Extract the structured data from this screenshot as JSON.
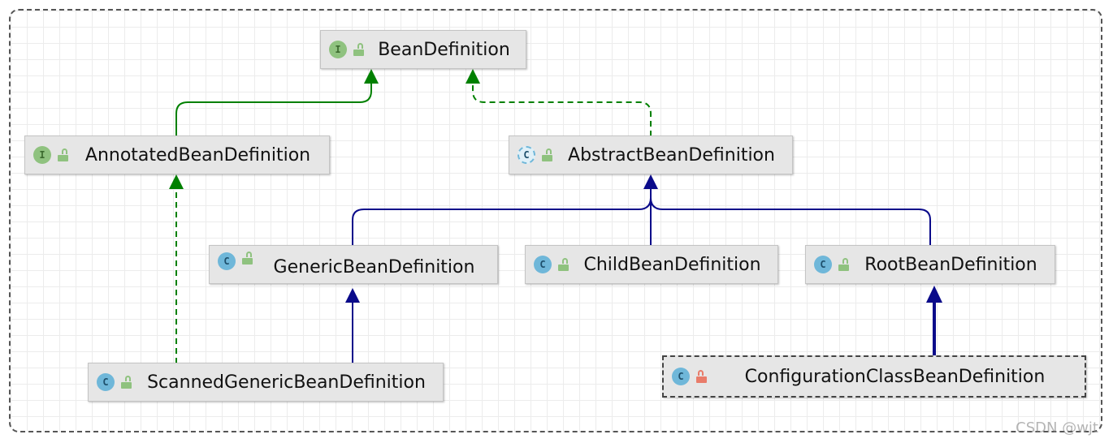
{
  "colors": {
    "interface_edge": "#008000",
    "class_edge": "#0a0a8a",
    "node_bg": "#e6e6e6"
  },
  "nodes": {
    "bean_definition": {
      "label": "BeanDefinition",
      "kind": "interface",
      "badge": "I",
      "visibility": "public"
    },
    "annotated_bean_definition": {
      "label": "AnnotatedBeanDefinition",
      "kind": "interface",
      "badge": "I",
      "visibility": "public"
    },
    "abstract_bean_definition": {
      "label": "AbstractBeanDefinition",
      "kind": "abstract-class",
      "badge": "C",
      "visibility": "public"
    },
    "generic_bean_definition": {
      "label": "GenericBeanDefinition",
      "kind": "class",
      "badge": "C",
      "visibility": "public"
    },
    "child_bean_definition": {
      "label": "ChildBeanDefinition",
      "kind": "class",
      "badge": "C",
      "visibility": "public"
    },
    "root_bean_definition": {
      "label": "RootBeanDefinition",
      "kind": "class",
      "badge": "C",
      "visibility": "public"
    },
    "scanned_generic_bean_definition": {
      "label": "ScannedGenericBeanDefinition",
      "kind": "class",
      "badge": "C",
      "visibility": "public"
    },
    "configuration_class_bean_definition": {
      "label": "ConfigurationClassBeanDefinition",
      "kind": "class",
      "badge": "C",
      "visibility": "private"
    }
  },
  "edges": [
    {
      "from": "annotated_bean_definition",
      "to": "bean_definition",
      "type": "extends"
    },
    {
      "from": "abstract_bean_definition",
      "to": "bean_definition",
      "type": "implements"
    },
    {
      "from": "generic_bean_definition",
      "to": "abstract_bean_definition",
      "type": "extends"
    },
    {
      "from": "child_bean_definition",
      "to": "abstract_bean_definition",
      "type": "extends"
    },
    {
      "from": "root_bean_definition",
      "to": "abstract_bean_definition",
      "type": "extends"
    },
    {
      "from": "scanned_generic_bean_definition",
      "to": "annotated_bean_definition",
      "type": "implements"
    },
    {
      "from": "scanned_generic_bean_definition",
      "to": "generic_bean_definition",
      "type": "extends"
    },
    {
      "from": "configuration_class_bean_definition",
      "to": "root_bean_definition",
      "type": "extends"
    }
  ],
  "watermark": "CSDN @wjt"
}
